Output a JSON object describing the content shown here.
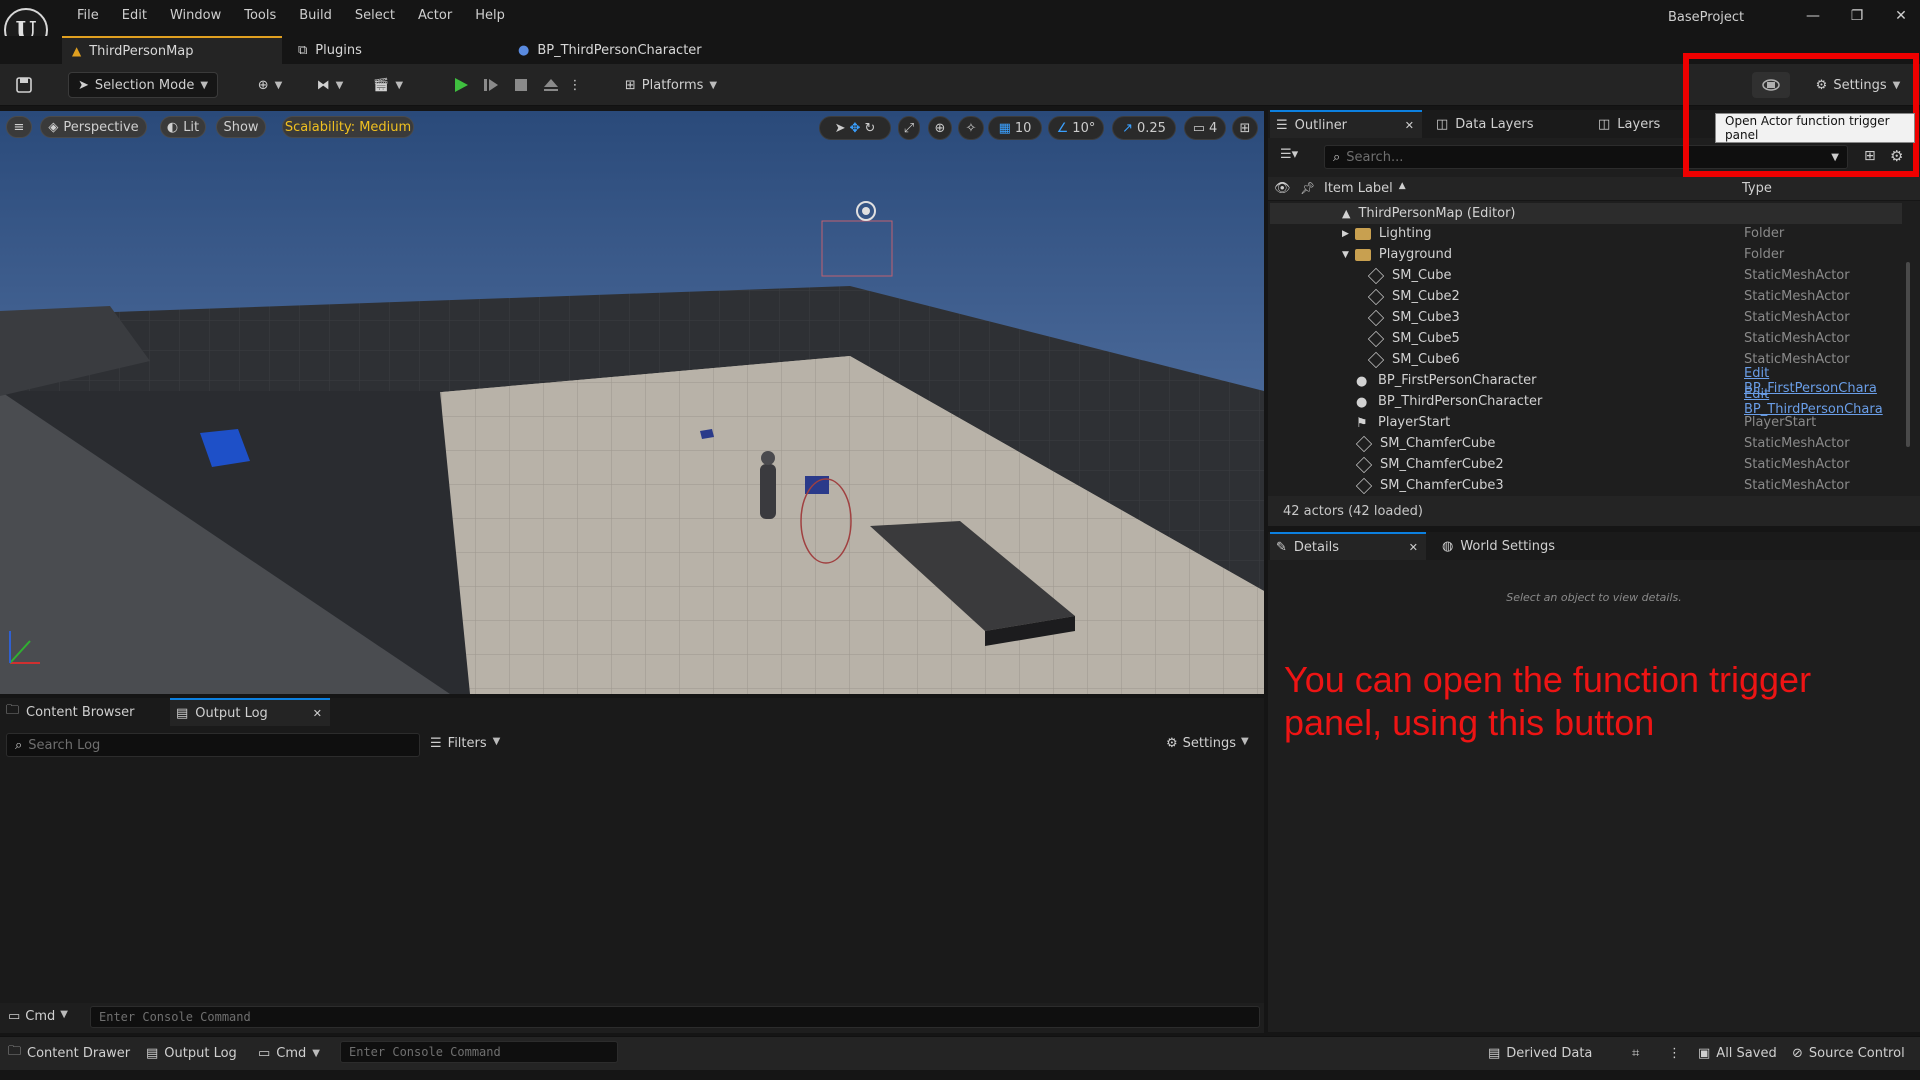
{
  "app": {
    "project_name": "BaseProject",
    "menu": [
      "File",
      "Edit",
      "Window",
      "Tools",
      "Build",
      "Select",
      "Actor",
      "Help"
    ],
    "window_controls": [
      "minimize",
      "maximize",
      "close"
    ]
  },
  "doc_tabs": [
    {
      "label": "ThirdPersonMap",
      "active": true
    },
    {
      "label": "Plugins",
      "active": false
    },
    {
      "label": "BP_ThirdPersonCharacter",
      "active": false
    }
  ],
  "toolbar": {
    "selection_mode": "Selection Mode",
    "platforms": "Platforms",
    "settings": "Settings"
  },
  "viewport": {
    "perspective": "Perspective",
    "lit": "Lit",
    "show": "Show",
    "scalability": "Scalability: Medium",
    "grid_snap": "10",
    "rotation_snap": "10°",
    "scale_snap": "0.25",
    "camera_speed": "4"
  },
  "outliner": {
    "tabs": [
      {
        "label": "Outliner",
        "active": true
      },
      {
        "label": "Data Layers",
        "active": false
      },
      {
        "label": "Layers",
        "active": false
      }
    ],
    "search_placeholder": "Search...",
    "col_label": "Item Label",
    "col_type": "Type",
    "rows": [
      {
        "label": "ThirdPersonMap (Editor)",
        "type": "",
        "kind": "map",
        "indent": 0
      },
      {
        "label": "Lighting",
        "type": "Folder",
        "kind": "folder",
        "indent": 1
      },
      {
        "label": "Playground",
        "type": "Folder",
        "kind": "folder-open",
        "indent": 1
      },
      {
        "label": "SM_Cube",
        "type": "StaticMeshActor",
        "kind": "mesh",
        "indent": 2
      },
      {
        "label": "SM_Cube2",
        "type": "StaticMeshActor",
        "kind": "mesh",
        "indent": 2
      },
      {
        "label": "SM_Cube3",
        "type": "StaticMeshActor",
        "kind": "mesh",
        "indent": 2
      },
      {
        "label": "SM_Cube5",
        "type": "StaticMeshActor",
        "kind": "mesh",
        "indent": 2
      },
      {
        "label": "SM_Cube6",
        "type": "StaticMeshActor",
        "kind": "mesh",
        "indent": 2
      },
      {
        "label": "BP_FirstPersonCharacter",
        "type": "Edit BP_FirstPersonChara",
        "kind": "person",
        "indent": 1,
        "link": true
      },
      {
        "label": "BP_ThirdPersonCharacter",
        "type": "Edit BP_ThirdPersonChara",
        "kind": "person",
        "indent": 1,
        "link": true
      },
      {
        "label": "PlayerStart",
        "type": "PlayerStart",
        "kind": "start",
        "indent": 1
      },
      {
        "label": "SM_ChamferCube",
        "type": "StaticMeshActor",
        "kind": "mesh",
        "indent": 1
      },
      {
        "label": "SM_ChamferCube2",
        "type": "StaticMeshActor",
        "kind": "mesh",
        "indent": 1
      },
      {
        "label": "SM_ChamferCube3",
        "type": "StaticMeshActor",
        "kind": "mesh",
        "indent": 1
      }
    ],
    "footer": "42 actors (42 loaded)"
  },
  "details": {
    "tabs": [
      {
        "label": "Details",
        "active": true
      },
      {
        "label": "World Settings",
        "active": false
      }
    ],
    "empty_text": "Select an object to view details."
  },
  "tooltip": "Open Actor function trigger panel",
  "annotation": "You can open the function trigger panel, using this button",
  "bottom_panel": {
    "tabs": [
      {
        "label": "Content Browser",
        "active": false
      },
      {
        "label": "Output Log",
        "active": true
      }
    ],
    "search_placeholder": "Search Log",
    "filters": "Filters",
    "settings": "Settings",
    "cmd": "Cmd",
    "console_placeholder": "Enter Console Command"
  },
  "statusbar": {
    "content_drawer": "Content Drawer",
    "output_log": "Output Log",
    "cmd": "Cmd",
    "console_placeholder": "Enter Console Command",
    "derived_data": "Derived Data",
    "all_saved": "All Saved",
    "source_control": "Source Control"
  },
  "colors": {
    "accent_blue": "#0c80e0",
    "tab_accent": "#e0a020",
    "annotation_red": "#ee0000",
    "play_green": "#3fbf3f"
  }
}
